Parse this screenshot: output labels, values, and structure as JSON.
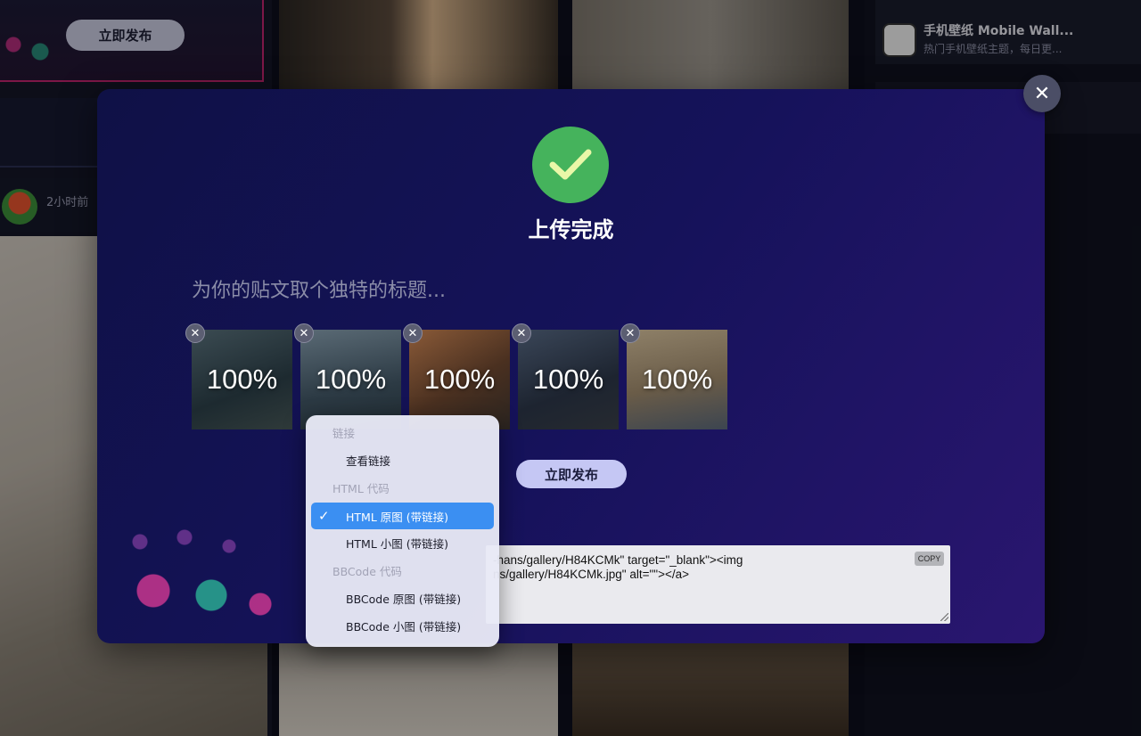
{
  "background": {
    "promo_button": "立即发布",
    "user_time": "2小时前",
    "app_title": "手机壁纸 Mobile Wall...",
    "app_subtitle": "热门手机壁纸主题，每日更..."
  },
  "modal": {
    "close_icon": "close-icon",
    "success_icon": "checkmark-icon",
    "title": "上传完成",
    "title_placeholder": "为你的贴文取个独特的标题...",
    "thumbnails": [
      {
        "progress": "100%",
        "progress_value": 1.0,
        "color": "#2c3a3f"
      },
      {
        "progress": "100%",
        "progress_value": 1.0,
        "color": "#3d4b55"
      },
      {
        "progress": "100%",
        "progress_value": 1.0,
        "color": "#6b4d35"
      },
      {
        "progress": "100%",
        "progress_value": 1.0,
        "color": "#2b3340"
      },
      {
        "progress": "100%",
        "progress_value": 1.0,
        "color": "#7d6d55"
      }
    ],
    "publish_label": "立即发布",
    "code_text": "-hans/gallery/H84KCMk\" target=\"_blank\"><img\nns/gallery/H84KCMk.jpg\" alt=\"\"></a>",
    "copy_label": "COPY"
  },
  "dropdown": {
    "group_link": "链接",
    "view_link": "查看链接",
    "group_html": "HTML 代码",
    "html_full": "HTML 原图 (带链接)",
    "html_small": "HTML 小图 (带链接)",
    "group_bbcode": "BBCode 代码",
    "bbcode_full": "BBCode 原图 (带链接)",
    "bbcode_small": "BBCode 小图 (带链接)",
    "selected": "HTML 原图 (带链接)",
    "selected_color": "#3b8ff2"
  },
  "colors": {
    "success_green": "#45b35c",
    "modal_bg": "#13124f",
    "publish_btn": "#c5c7f4"
  }
}
